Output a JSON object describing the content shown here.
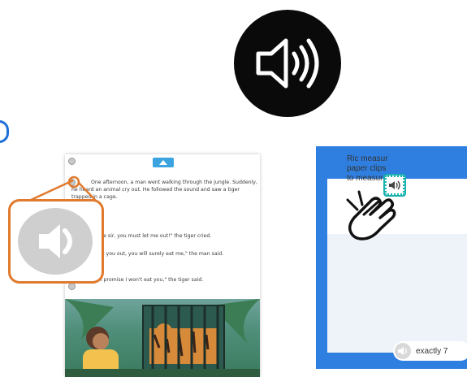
{
  "hero": {
    "icon": "speaker-volume-icon",
    "color": "#0a0a0a"
  },
  "book": {
    "paragraphs": [
      "One afternoon, a man went walking through the jungle. Suddenly, he heard an animal cry out. He followed the sound and saw a tiger trapped in a cage.",
      "\"Please sir, you must let me out!\" the tiger cried.",
      "\"If I let you out, you will surely eat me,\" the man said.",
      "\"No! I promise I won't eat you,\" the tiger said."
    ]
  },
  "callout": {
    "icon": "speaker-icon",
    "border_color": "#e07a2e"
  },
  "quiz": {
    "question": "Ric measur\npaper clips\nto measure",
    "answer": "exactly 7",
    "panel_color": "#2f7fe0",
    "highlight_color": "#1ab0ad"
  }
}
